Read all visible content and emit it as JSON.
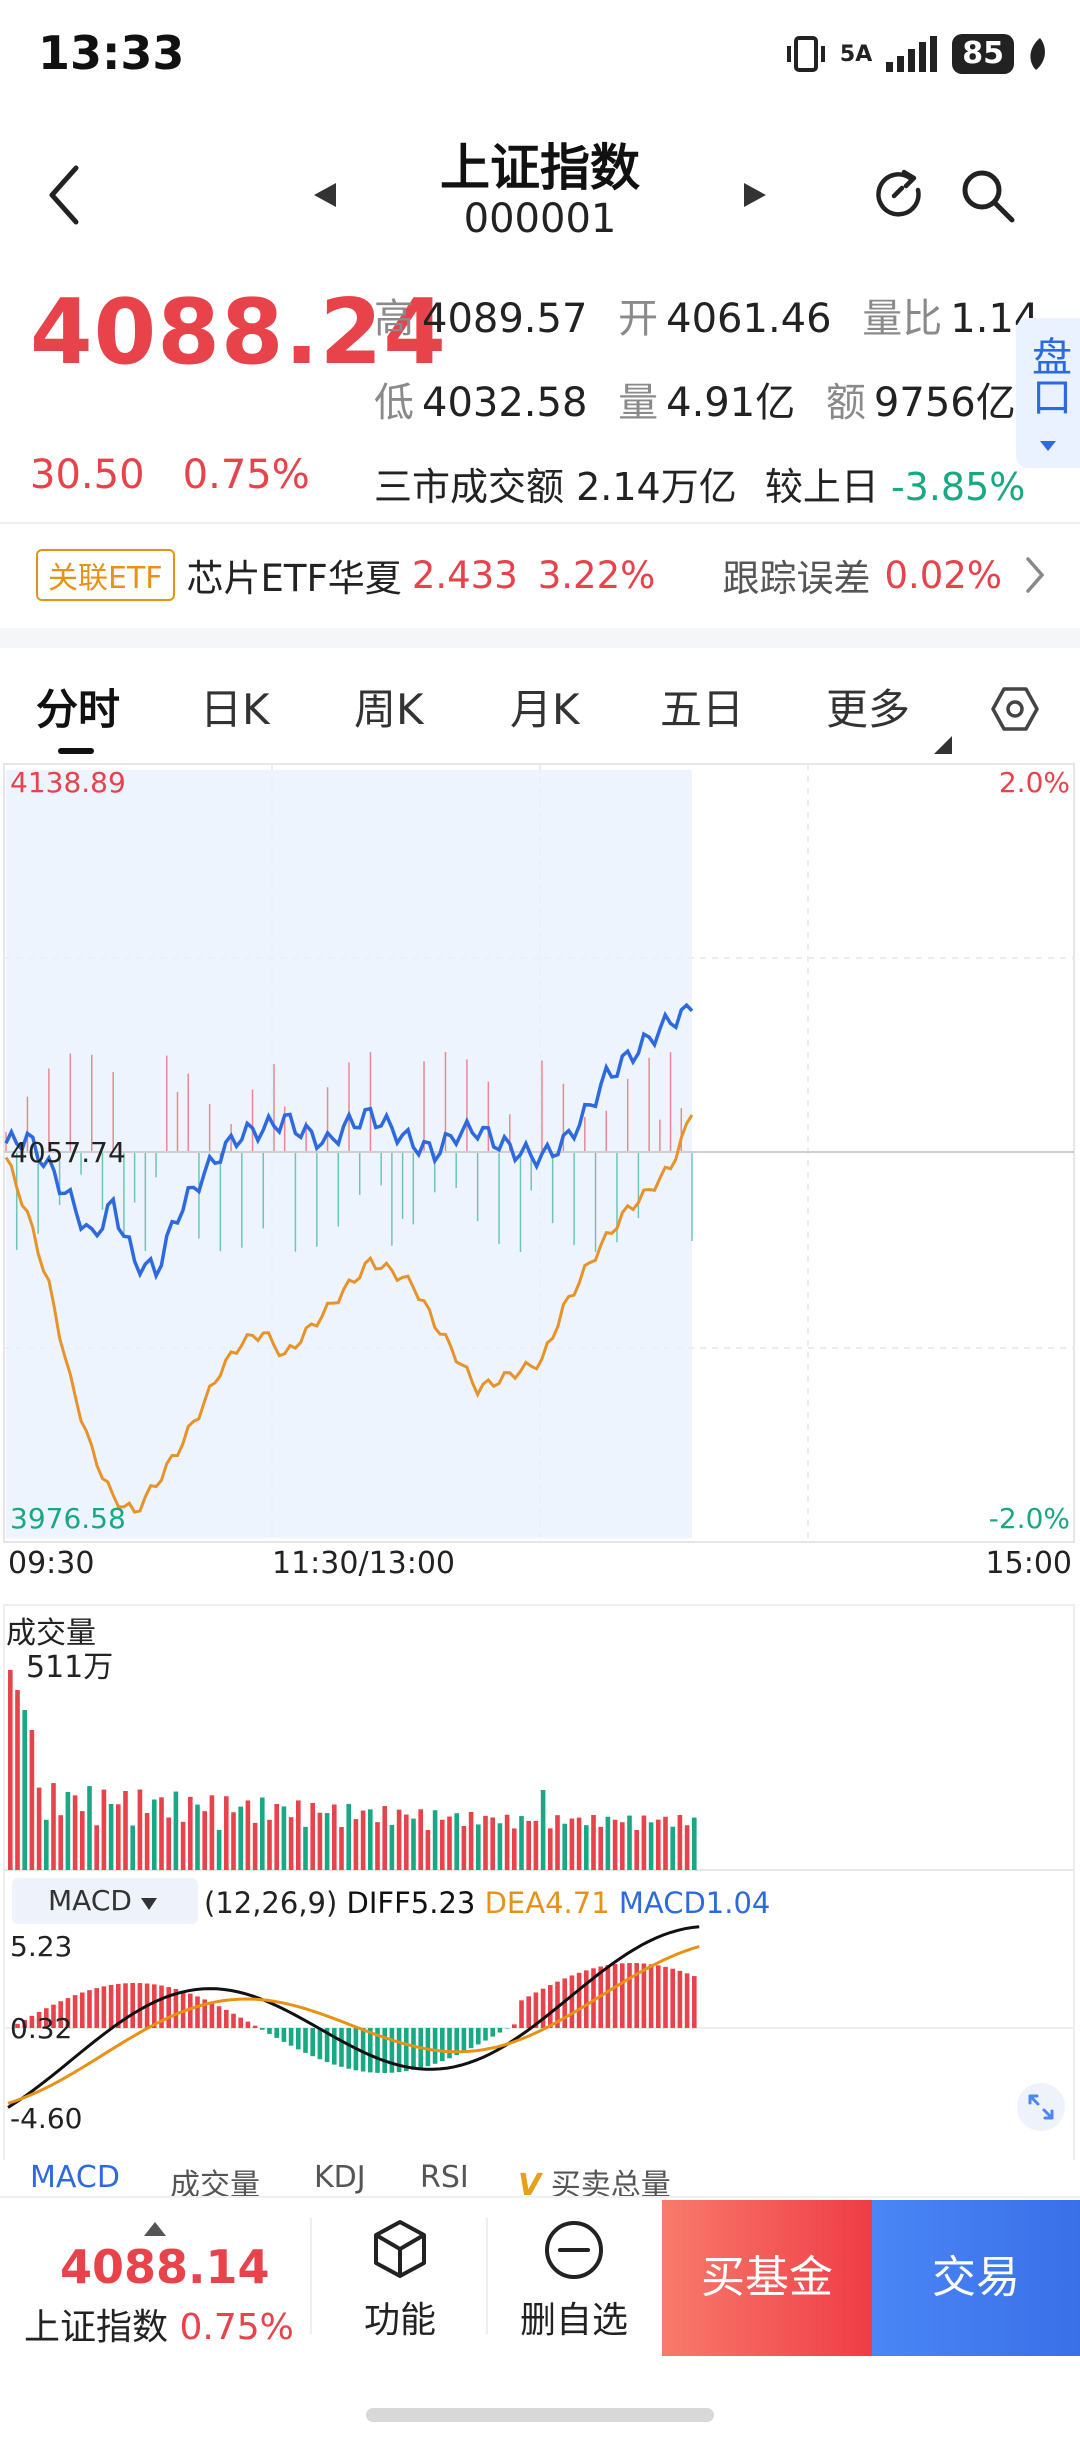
{
  "status_bar": {
    "time": "13:33",
    "network": "5A",
    "battery": "85"
  },
  "header": {
    "title": "上证指数",
    "code": "000001"
  },
  "quote": {
    "price": "4088.24",
    "change_abs": "30.50",
    "change_pct": "0.75%",
    "high_label": "高",
    "high": "4089.57",
    "open_label": "开",
    "open": "4061.46",
    "ratio_label": "量比",
    "ratio": "1.14",
    "low_label": "低",
    "low": "4032.58",
    "vol_label": "量",
    "vol": "4.91亿",
    "amount_label": "额",
    "amount": "9756亿",
    "pankou": "盘口",
    "turnover_label": "三市成交额",
    "turnover": "2.14万亿",
    "vs_prev_label": "较上日",
    "vs_prev": "-3.85%"
  },
  "etf": {
    "tag": "关联ETF",
    "name": "芯片ETF华夏",
    "price": "2.433",
    "pct": "3.22%",
    "tracking_label": "跟踪误差",
    "tracking": "0.02%"
  },
  "tabs": [
    "分时",
    "日K",
    "周K",
    "月K",
    "五日",
    "更多"
  ],
  "chart": {
    "top_price": "4138.89",
    "top_pct": "2.0%",
    "mid_price": "4057.74",
    "bottom_price": "3976.58",
    "bottom_pct": "-2.0%",
    "time_start": "09:30",
    "time_mid": "11:30/13:00",
    "time_end": "15:00",
    "volume_title": "成交量",
    "volume_max": "511万",
    "macd_selector": "MACD",
    "macd_params": "(12,26,9)",
    "diff_label": "DIFF5.23",
    "dea_label": "DEA4.71",
    "macd_label": "MACD1.04",
    "macd_top": "5.23",
    "macd_mid": "0.32",
    "macd_bottom": "-4.60",
    "colors": {
      "up": "#e8424a",
      "down": "#19a884",
      "price_line": "#2d6ae0",
      "avg_line": "#e8922a"
    }
  },
  "chart_data": {
    "type": "line",
    "ylim": [
      3976.58,
      4138.89
    ],
    "series": [
      {
        "name": "",
        "values": [
          4060,
          4061,
          4055,
          4048,
          4040,
          4047,
          4035,
          4033,
          4045,
          4052,
          4058,
          4062,
          4063,
          4065,
          4062,
          4060,
          4064,
          4066,
          4063,
          4060,
          4058,
          4062,
          4063,
          4060,
          4058,
          4057,
          4060,
          4066,
          4074,
          4078,
          4082,
          4086,
          4088
        ]
      },
      {
        "name": "",
        "values": [
          4057,
          4045,
          4030,
          4010,
          3995,
          3985,
          3982,
          3988,
          3995,
          4003,
          4012,
          4018,
          4020,
          4015,
          4020,
          4025,
          4030,
          4035,
          4033,
          4030,
          4022,
          4015,
          4008,
          4010,
          4012,
          4014,
          4025,
          4033,
          4040,
          4046,
          4050,
          4055,
          4066
        ]
      }
    ]
  },
  "indicator_tabs": [
    "MACD",
    "成交量",
    "KDJ",
    "RSI",
    "买卖总量"
  ],
  "bottom": {
    "price": "4088.14",
    "name": "上证指数",
    "pct": "0.75%",
    "func_label": "功能",
    "remove_label": "删自选",
    "buy_fund": "买基金",
    "trade": "交易"
  }
}
